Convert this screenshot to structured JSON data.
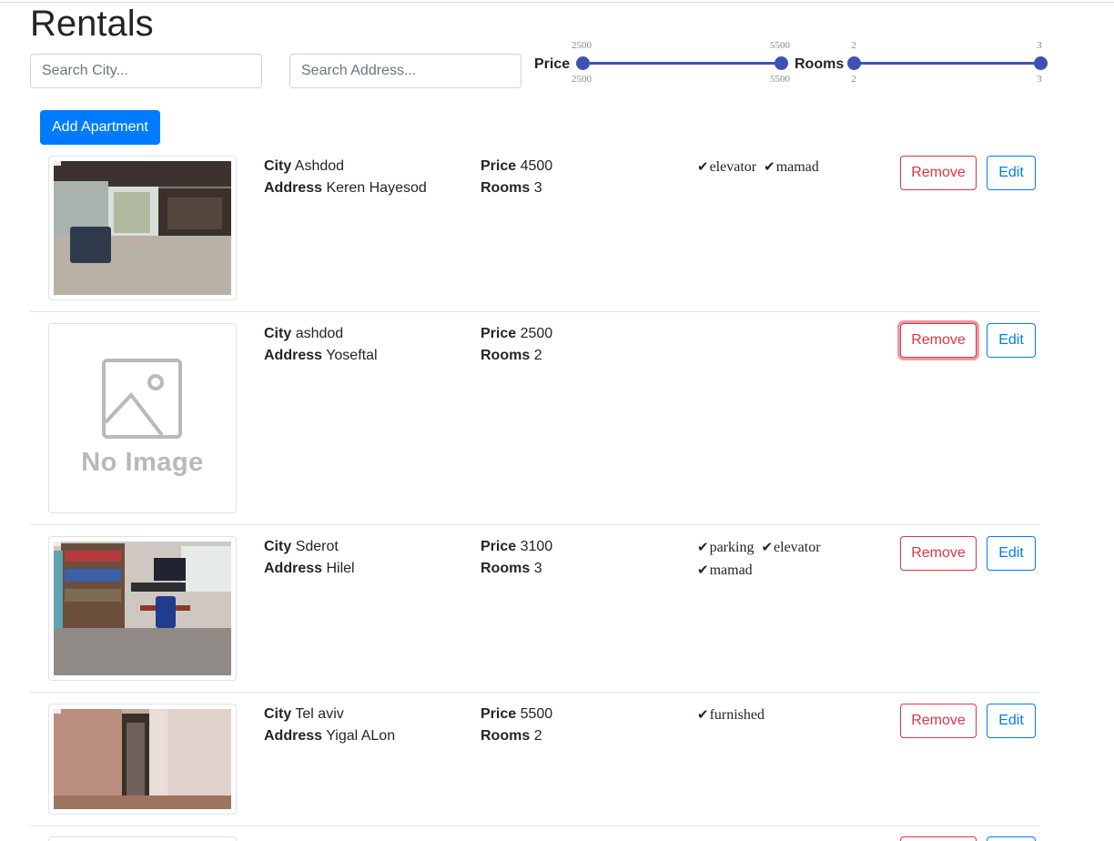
{
  "page": {
    "title": "Rentals"
  },
  "search": {
    "city_placeholder": "Search City...",
    "address_placeholder": "Search Address..."
  },
  "filters": {
    "price": {
      "label": "Price",
      "min": "2500",
      "max": "5500",
      "selected_min": "2500",
      "selected_max": "5500"
    },
    "rooms": {
      "label": "Rooms",
      "min": "2",
      "max": "3",
      "selected_min": "2",
      "selected_max": "3"
    }
  },
  "actions": {
    "add_label": "Add Apartment"
  },
  "labels": {
    "city": "City",
    "address": "Address",
    "price": "Price",
    "rooms": "Rooms",
    "remove": "Remove",
    "edit": "Edit",
    "no_image": "No Image"
  },
  "listings": [
    {
      "city": "Ashdod",
      "address": "Keren Hayesod",
      "price": "4500",
      "rooms": "3",
      "features": [
        "elevator",
        "mamad"
      ],
      "image": "living-room-photo"
    },
    {
      "city": "ashdod",
      "address": "Yoseftal",
      "price": "2500",
      "rooms": "2",
      "features": [],
      "image": "no-image-placeholder"
    },
    {
      "city": "Sderot",
      "address": "Hilel",
      "price": "3100",
      "rooms": "3",
      "features": [
        "parking",
        "elevator",
        "mamad"
      ],
      "image": "office-room-photo"
    },
    {
      "city": "Tel aviv",
      "address": "Yigal ALon",
      "price": "5500",
      "rooms": "2",
      "features": [
        "furnished"
      ],
      "image": "hallway-photo"
    }
  ],
  "colors": {
    "primary": "#007bff",
    "danger": "#dc3545",
    "slider": "#3f51b5"
  }
}
